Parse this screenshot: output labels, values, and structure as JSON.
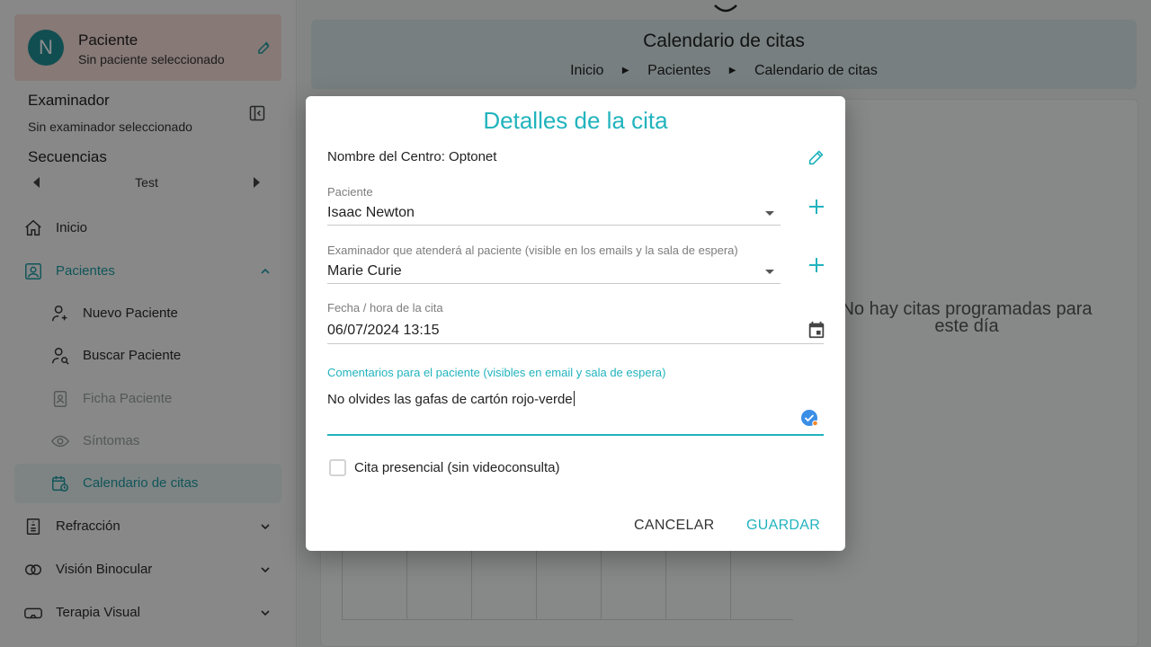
{
  "sidebar": {
    "patient_card": {
      "avatar_letter": "N",
      "title": "Paciente",
      "subtitle": "Sin paciente seleccionado"
    },
    "examiner": {
      "title": "Examinador",
      "subtitle": "Sin examinador seleccionado"
    },
    "sequences": {
      "title": "Secuencias",
      "current": "Test"
    },
    "nav": {
      "inicio": "Inicio",
      "pacientes": "Pacientes",
      "nuevo": "Nuevo Paciente",
      "buscar": "Buscar Paciente",
      "ficha": "Ficha Paciente",
      "sintomas": "Síntomas",
      "calendario": "Calendario de citas",
      "refraccion": "Refracción",
      "vision": "Visión Binocular",
      "terapia": "Terapia Visual"
    }
  },
  "header": {
    "title": "Calendario de citas",
    "breadcrumb": [
      "Inicio",
      "Pacientes",
      "Calendario de citas"
    ]
  },
  "calendar": {
    "empty_message": "No hay citas programadas para este día"
  },
  "dialog": {
    "title": "Detalles de la cita",
    "centro": "Nombre del Centro: Optonet",
    "patient": {
      "label": "Paciente",
      "value": "Isaac Newton"
    },
    "examiner": {
      "label": "Examinador que atenderá al paciente (visible en los emails y la sala de espera)",
      "value": "Marie Curie"
    },
    "date": {
      "label": "Fecha / hora de la cita",
      "value": "06/07/2024 13:15"
    },
    "comments": {
      "label": "Comentarios para el paciente (visibles en email y sala de espera)",
      "value": "No olvides las gafas de cartón rojo-verde"
    },
    "presencial_label": "Cita presencial (sin videoconsulta)",
    "cancel": "CANCELAR",
    "save": "GUARDAR"
  },
  "colors": {
    "accent": "#21b3bd",
    "teal_dark": "#1f8f96",
    "patient_card_bg": "#f5dcd7"
  }
}
